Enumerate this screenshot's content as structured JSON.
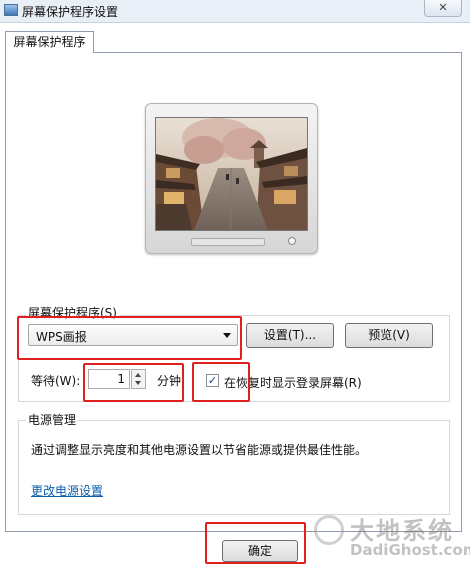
{
  "window": {
    "title": "屏幕保护程序设置",
    "close_label": "✕"
  },
  "tab": {
    "label": "屏幕保护程序"
  },
  "screensaver": {
    "group_label": "屏幕保护程序(S)",
    "selected": "WPS画报",
    "settings_button": "设置(T)...",
    "preview_button": "预览(V)",
    "wait_label": "等待(W):",
    "wait_value": "1",
    "wait_unit": "分钟",
    "resume_label": "在恢复时显示登录屏幕(R)",
    "resume_checked": true
  },
  "power": {
    "group_label": "电源管理",
    "description": "通过调整显示亮度和其他电源设置以节省能源或提供最佳性能。",
    "link": "更改电源设置"
  },
  "footer": {
    "ok_button": "确定"
  },
  "watermark": {
    "cn": "大地系统",
    "en": "DadiGhost.com"
  },
  "colors": {
    "highlight": "#e02020",
    "link": "#0b5cad"
  }
}
